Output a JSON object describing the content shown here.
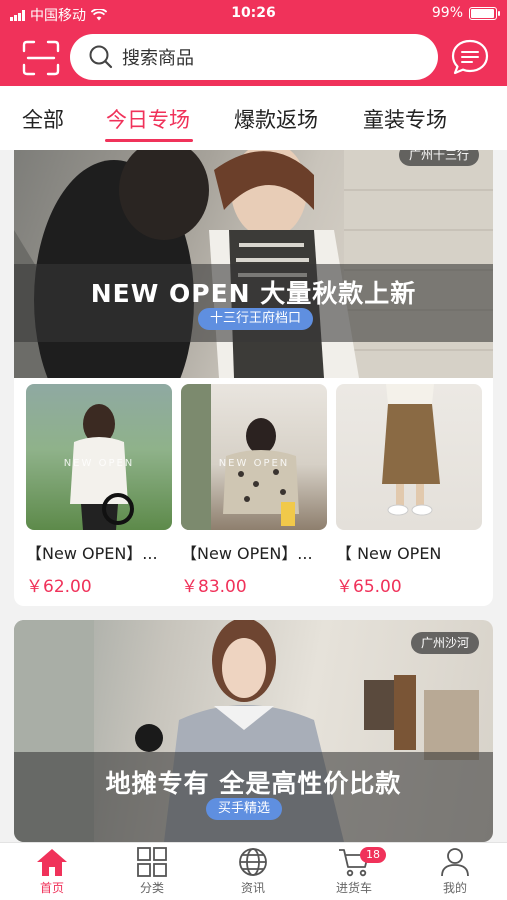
{
  "status_bar": {
    "carrier": "中国移动",
    "time": "10:26",
    "battery": "99%"
  },
  "search": {
    "placeholder": "搜索商品"
  },
  "tabs": [
    {
      "label": "全部",
      "active": false
    },
    {
      "label": "今日专场",
      "active": true
    },
    {
      "label": "爆款返场",
      "active": false
    },
    {
      "label": "童装专场",
      "active": false
    }
  ],
  "feed": [
    {
      "location_tag": "广州十三行",
      "banner_title": "NEW OPEN 大量秋款上新",
      "banner_tag": "十三行王府档口",
      "products": [
        {
          "name": "【New OPEN】...",
          "price": "￥62.00",
          "thumb_text": "NEW OPEN"
        },
        {
          "name": "【New OPEN】...",
          "price": "￥83.00",
          "thumb_text": "NEW OPEN"
        },
        {
          "name": "【 New OPEN",
          "price": "￥65.00",
          "thumb_text": ""
        }
      ]
    },
    {
      "location_tag": "广州沙河",
      "banner_title": "地摊专有 全是高性价比款",
      "banner_tag": "买手精选"
    }
  ],
  "tab_bar": {
    "items": [
      {
        "label": "首页",
        "icon": "home-icon",
        "active": true
      },
      {
        "label": "分类",
        "icon": "category-grid-icon",
        "active": false
      },
      {
        "label": "资讯",
        "icon": "globe-icon",
        "active": false
      },
      {
        "label": "进货车",
        "icon": "cart-icon",
        "active": false,
        "badge": "18"
      },
      {
        "label": "我的",
        "icon": "user-icon",
        "active": false
      }
    ]
  },
  "colors": {
    "accent": "#f0325a",
    "tag_blue": "#5f8fe0"
  }
}
